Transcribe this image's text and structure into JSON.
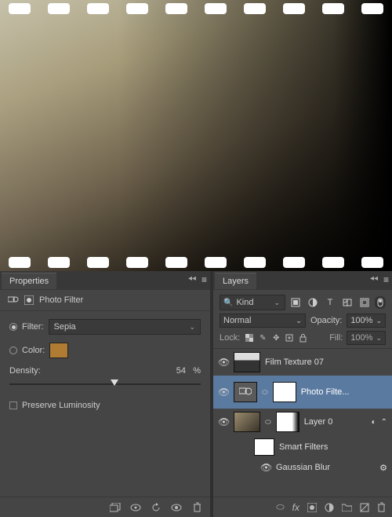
{
  "canvas": {
    "alt": "Sepia film photo of Brooklyn Bridge with film sprocket borders"
  },
  "properties": {
    "tab": "Properties",
    "title": "Photo Filter",
    "filter_label": "Filter:",
    "filter_value": "Sepia",
    "color_label": "Color:",
    "color_hex": "#b07c33",
    "density_label": "Density:",
    "density_value": "54",
    "density_pct": "%",
    "preserve_label": "Preserve Luminosity"
  },
  "layers": {
    "tab": "Layers",
    "kind_label": "Kind",
    "blend_mode": "Normal",
    "opacity_label": "Opacity:",
    "opacity_value": "100%",
    "lock_label": "Lock:",
    "fill_label": "Fill:",
    "fill_value": "100%",
    "items": [
      {
        "name": "Film Texture 07"
      },
      {
        "name": "Photo Filte..."
      },
      {
        "name": "Layer 0"
      },
      {
        "name": "Smart Filters"
      },
      {
        "name": "Gaussian Blur"
      }
    ]
  }
}
